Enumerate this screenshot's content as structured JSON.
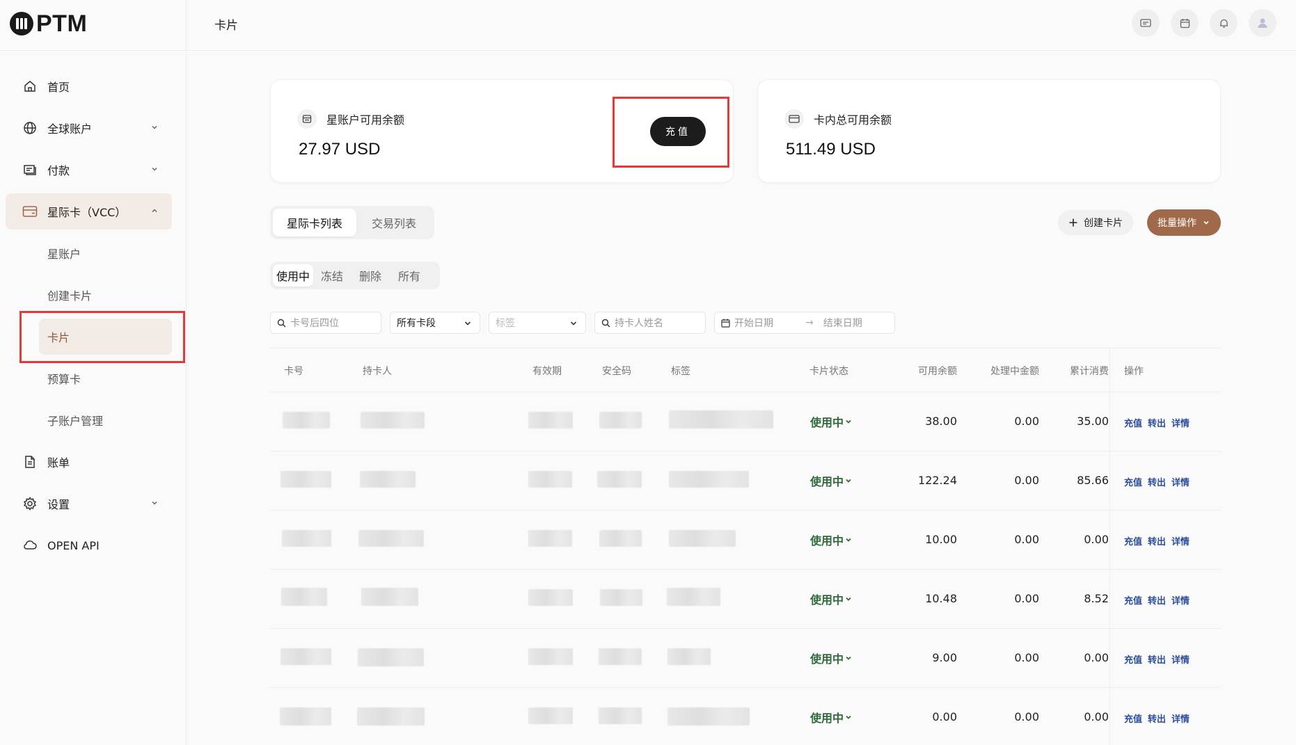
{
  "app": {
    "logo_text": "PTM"
  },
  "sidebar": {
    "items": [
      {
        "label": "首页",
        "icon": "home-icon"
      },
      {
        "label": "全球账户",
        "icon": "globe-icon"
      },
      {
        "label": "付款",
        "icon": "payment-icon"
      },
      {
        "label": "星际卡（VCC）",
        "icon": "card-icon"
      },
      {
        "label": "账单",
        "icon": "document-icon"
      },
      {
        "label": "设置",
        "icon": "gear-icon"
      },
      {
        "label": "OPEN API",
        "icon": "cloud-icon"
      }
    ],
    "sub_items": [
      {
        "label": "星账户"
      },
      {
        "label": "创建卡片"
      },
      {
        "label": "卡片"
      },
      {
        "label": "预算卡"
      },
      {
        "label": "子账户管理"
      }
    ],
    "selected": "卡片"
  },
  "header": {
    "title": "卡片",
    "icons": [
      "card-swap-icon",
      "calendar-icon",
      "bell-icon",
      "avatar-icon"
    ]
  },
  "balances": {
    "star_account": {
      "label": "星账户可用余额",
      "amount": "27.97 USD",
      "button": "充值"
    },
    "card_total": {
      "label": "卡内总可用余额",
      "amount": "511.49 USD"
    }
  },
  "tabs": {
    "main": [
      {
        "label": "星际卡列表"
      },
      {
        "label": "交易列表"
      }
    ],
    "status": [
      {
        "label": "使用中"
      },
      {
        "label": "冻结"
      },
      {
        "label": "删除"
      },
      {
        "label": "所有"
      }
    ]
  },
  "toolbar": {
    "create_label": "创建卡片",
    "batch_label": "批量操作"
  },
  "filters": {
    "card_last4_placeholder": "卡号后四位",
    "card_segment": "所有卡段",
    "tag_placeholder": "标签",
    "holder_placeholder": "持卡人姓名",
    "start_date_placeholder": "开始日期",
    "end_date_placeholder": "结束日期"
  },
  "table": {
    "columns": [
      "卡号",
      "持卡人",
      "有效期",
      "安全码",
      "标签",
      "卡片状态",
      "可用余额",
      "处理中金额",
      "累计消费",
      "操作"
    ],
    "rows": [
      {
        "status": "使用中",
        "available": "38.00",
        "pending": "0.00",
        "spent": "35.00"
      },
      {
        "status": "使用中",
        "available": "122.24",
        "pending": "0.00",
        "spent": "85.66"
      },
      {
        "status": "使用中",
        "available": "10.00",
        "pending": "0.00",
        "spent": "0.00"
      },
      {
        "status": "使用中",
        "available": "10.48",
        "pending": "0.00",
        "spent": "8.52"
      },
      {
        "status": "使用中",
        "available": "9.00",
        "pending": "0.00",
        "spent": "0.00"
      },
      {
        "status": "使用中",
        "available": "0.00",
        "pending": "0.00",
        "spent": "0.00"
      }
    ],
    "actions": [
      "充值",
      "转出",
      "详情"
    ]
  },
  "colors": {
    "accent": "#a0694a",
    "status_green": "#2e6b3a",
    "action_blue": "#2d4e9a",
    "highlight_red": "#e53935"
  }
}
